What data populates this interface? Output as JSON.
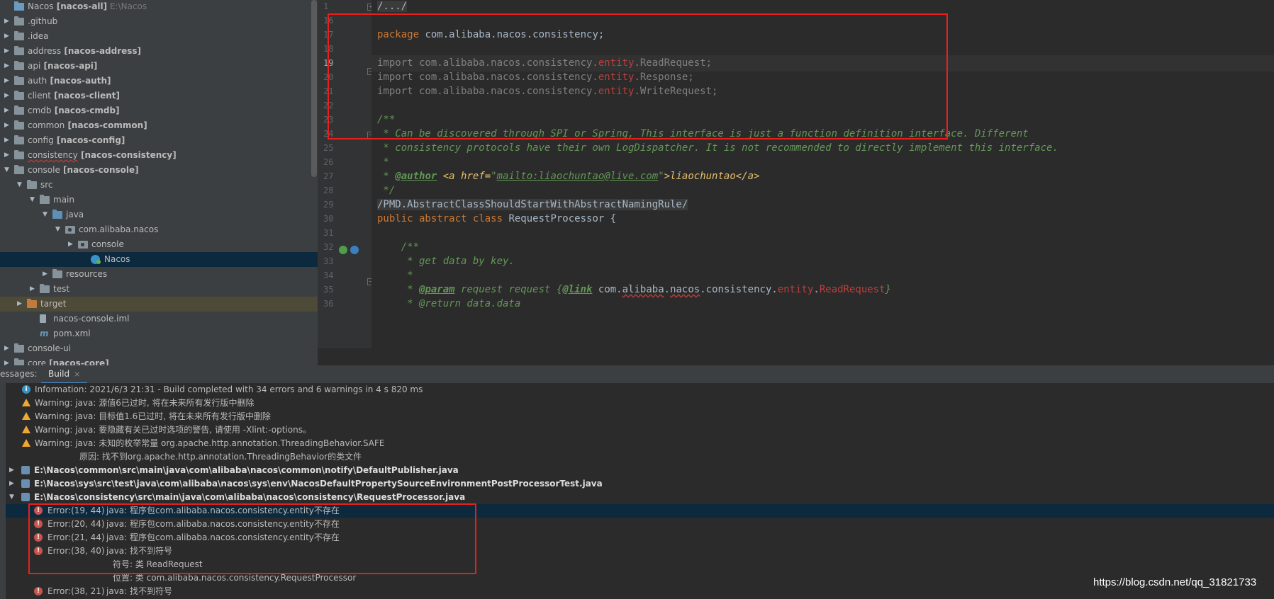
{
  "project_tree": {
    "items": [
      {
        "label": "Nacos",
        "module": "[nacos-all]",
        "path": "E:\\Nacos",
        "indent": 0,
        "arrow": "",
        "icon": "module"
      },
      {
        "label": ".github",
        "module": "",
        "path": "",
        "indent": 0,
        "arrow": "▶",
        "icon": "folder"
      },
      {
        "label": ".idea",
        "module": "",
        "path": "",
        "indent": 0,
        "arrow": "▶",
        "icon": "folder"
      },
      {
        "label": "address",
        "module": "[nacos-address]",
        "path": "",
        "indent": 0,
        "arrow": "▶",
        "icon": "folder"
      },
      {
        "label": "api",
        "module": "[nacos-api]",
        "path": "",
        "indent": 0,
        "arrow": "▶",
        "icon": "folder"
      },
      {
        "label": "auth",
        "module": "[nacos-auth]",
        "path": "",
        "indent": 0,
        "arrow": "▶",
        "icon": "folder"
      },
      {
        "label": "client",
        "module": "[nacos-client]",
        "path": "",
        "indent": 0,
        "arrow": "▶",
        "icon": "folder"
      },
      {
        "label": "cmdb",
        "module": "[nacos-cmdb]",
        "path": "",
        "indent": 0,
        "arrow": "▶",
        "icon": "folder"
      },
      {
        "label": "common",
        "module": "[nacos-common]",
        "path": "",
        "indent": 0,
        "arrow": "▶",
        "icon": "folder"
      },
      {
        "label": "config",
        "module": "[nacos-config]",
        "path": "",
        "indent": 0,
        "arrow": "▶",
        "icon": "folder"
      },
      {
        "label": "consistency",
        "module": "[nacos-consistency]",
        "path": "",
        "indent": 0,
        "arrow": "▶",
        "icon": "folder"
      },
      {
        "label": "console",
        "module": "[nacos-console]",
        "path": "",
        "indent": 0,
        "arrow": "▼",
        "icon": "folder"
      },
      {
        "label": "src",
        "module": "",
        "path": "",
        "indent": 1,
        "arrow": "▼",
        "icon": "folder"
      },
      {
        "label": "main",
        "module": "",
        "path": "",
        "indent": 2,
        "arrow": "▼",
        "icon": "folder"
      },
      {
        "label": "java",
        "module": "",
        "path": "",
        "indent": 3,
        "arrow": "▼",
        "icon": "src"
      },
      {
        "label": "com.alibaba.nacos",
        "module": "",
        "path": "",
        "indent": 4,
        "arrow": "▼",
        "icon": "pkg"
      },
      {
        "label": "console",
        "module": "",
        "path": "",
        "indent": 5,
        "arrow": "▶",
        "icon": "pkg"
      },
      {
        "label": "Nacos",
        "module": "",
        "path": "",
        "indent": 6,
        "arrow": "",
        "icon": "java"
      },
      {
        "label": "resources",
        "module": "",
        "path": "",
        "indent": 3,
        "arrow": "▶",
        "icon": "folder"
      },
      {
        "label": "test",
        "module": "",
        "path": "",
        "indent": 2,
        "arrow": "▶",
        "icon": "folder"
      },
      {
        "label": "target",
        "module": "",
        "path": "",
        "indent": 1,
        "arrow": "▶",
        "icon": "tgt"
      },
      {
        "label": "nacos-console.iml",
        "module": "",
        "path": "",
        "indent": 2,
        "arrow": "",
        "icon": "iml"
      },
      {
        "label": "pom.xml",
        "module": "",
        "path": "",
        "indent": 2,
        "arrow": "",
        "icon": "pom"
      },
      {
        "label": "console-ui",
        "module": "",
        "path": "",
        "indent": 0,
        "arrow": "▶",
        "icon": "folder"
      },
      {
        "label": "core",
        "module": "[nacos-core]",
        "path": "",
        "indent": 0,
        "arrow": "▶",
        "icon": "folder"
      }
    ]
  },
  "editor": {
    "line_numbers": [
      "1",
      "16",
      "17",
      "18",
      "19",
      "20",
      "21",
      "22",
      "23",
      "24",
      "25",
      "26",
      "27",
      "28",
      "29",
      "30",
      "31",
      "32",
      "33",
      "34",
      "35",
      "36"
    ],
    "lines": {
      "l1": "/.../",
      "l17_kw": "package",
      "l17_rest": " com.alibaba.nacos.consistency;",
      "l19_a": "import com.alibaba.nacos.consistency.",
      "l19_e": "entity",
      "l19_b": ".ReadRequest;",
      "l20_a": "import com.alibaba.nacos.consistency.",
      "l20_e": "entity",
      "l20_b": ".Response;",
      "l21_a": "import com.alibaba.nacos.consistency.",
      "l21_e": "entity",
      "l21_b": ".WriteRequest;",
      "l23": "/**",
      "l24": " * Can be discovered through SPI or Spring, This interface is just a function definition interface. Different",
      "l25": " * consistency protocols have their own LogDispatcher. It is not recommended to directly implement this interface.",
      "l26": " *",
      "l27_a": " * ",
      "l27_tag": "@author",
      "l27_b": " <a href=",
      "l27_q1": "\"",
      "l27_link": "mailto:liaochuntao@live.com",
      "l27_q2": "\"",
      "l27_c": ">liaochuntao</a>",
      "l28": " */",
      "l29": "/PMD.AbstractClassShouldStartWithAbstractNamingRule/",
      "l30_kw": "public abstract class",
      "l30_rest": " RequestProcessor {",
      "l32": "    /**",
      "l33": "     * get data by key.",
      "l34": "     *",
      "l35_a": "     * ",
      "l35_tag": "@param",
      "l35_b": " request request {",
      "l35_link": "@link",
      "l35_c": " com.",
      "l35_d": "alibaba",
      "l35_e": ".",
      "l35_f": "nacos",
      "l35_g": ".consistency.",
      "l35_h": "entity",
      "l35_i": ".",
      "l35_j": "ReadRequest",
      "l35_k": "}",
      "l36": "     * @return data.data"
    }
  },
  "messages_panel": {
    "caption": "essages:",
    "tab_label": "Build",
    "tab_close": "×",
    "rows": [
      {
        "type": "info",
        "text": "Information: 2021/6/3 21:31 - Build completed with 34 errors and 6 warnings in 4 s 820 ms"
      },
      {
        "type": "warn",
        "text": "Warning: java: 源值6已过时, 将在未来所有发行版中删除"
      },
      {
        "type": "warn",
        "text": "Warning: java: 目标值1.6已过时, 将在未来所有发行版中删除"
      },
      {
        "type": "warn",
        "text": "Warning: java: 要隐藏有关已过时选项的警告, 请使用 -Xlint:-options。"
      },
      {
        "type": "warn",
        "text": "Warning: java: 未知的枚举常量 org.apache.http.annotation.ThreadingBehavior.SAFE"
      },
      {
        "type": "sub",
        "text": "原因: 找不到org.apache.http.annotation.ThreadingBehavior的类文件"
      },
      {
        "type": "file",
        "arrow": "▶",
        "text": "E:\\Nacos\\common\\src\\main\\java\\com\\alibaba\\nacos\\common\\notify\\DefaultPublisher.java"
      },
      {
        "type": "file",
        "arrow": "▶",
        "text": "E:\\Nacos\\sys\\src\\test\\java\\com\\alibaba\\nacos\\sys\\env\\NacosDefaultPropertySourceEnvironmentPostProcessorTest.java"
      },
      {
        "type": "file",
        "arrow": "▼",
        "text": "E:\\Nacos\\consistency\\src\\main\\java\\com\\alibaba\\nacos\\consistency\\RequestProcessor.java"
      },
      {
        "type": "err",
        "loc": "Error:(19, 44)",
        "text": "java: 程序包com.alibaba.nacos.consistency.entity不存在"
      },
      {
        "type": "err",
        "loc": "Error:(20, 44)",
        "text": "java: 程序包com.alibaba.nacos.consistency.entity不存在"
      },
      {
        "type": "err",
        "loc": "Error:(21, 44)",
        "text": "java: 程序包com.alibaba.nacos.consistency.entity不存在"
      },
      {
        "type": "err",
        "loc": "Error:(38, 40)",
        "text": "java: 找不到符号"
      },
      {
        "type": "sub2",
        "text": "符号:   类 ReadRequest"
      },
      {
        "type": "sub2",
        "text": "位置: 类 com.alibaba.nacos.consistency.RequestProcessor"
      },
      {
        "type": "err",
        "loc": "Error:(38, 21)",
        "text": "java: 找不到符号"
      }
    ]
  },
  "watermark": "https://blog.csdn.net/qq_31821733",
  "colors": {
    "highlight_box": "#e8201b",
    "selection": "#0d293e",
    "keyword": "#cc7832",
    "doc_comment": "#629755"
  }
}
